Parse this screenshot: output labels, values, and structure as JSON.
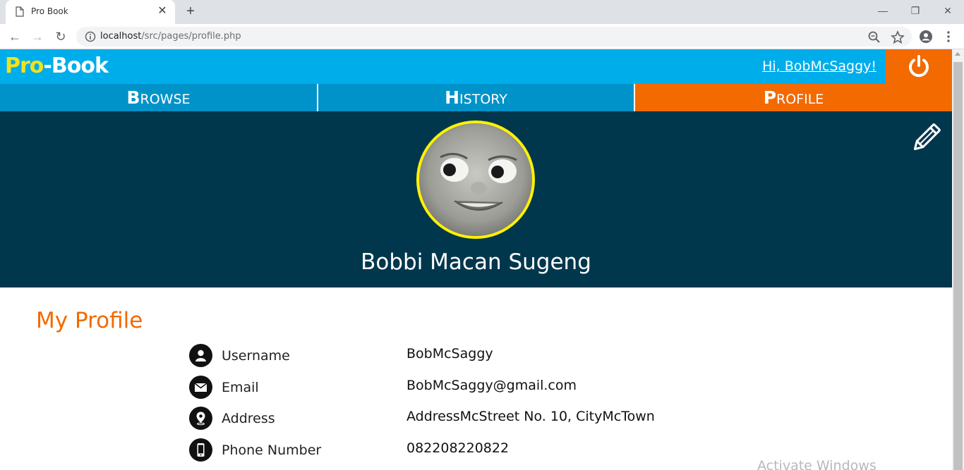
{
  "browser": {
    "tab_title": "Pro Book",
    "url_host": "localhost",
    "url_path": "/src/pages/profile.php"
  },
  "header": {
    "logo_pro": "Pro",
    "logo_book": "-Book",
    "greeting": "Hi, BobMcSaggy!"
  },
  "nav": {
    "browse": {
      "cap": "B",
      "rest": "ROWSE"
    },
    "history": {
      "cap": "H",
      "rest": "ISTORY"
    },
    "profile": {
      "cap": "P",
      "rest": "ROFILE"
    }
  },
  "profile": {
    "name": "Bobbi Macan Sugeng"
  },
  "section_title": "My Profile",
  "info": [
    {
      "label": "Username",
      "value": "BobMcSaggy",
      "icon": "user-icon"
    },
    {
      "label": "Email",
      "value": "BobMcSaggy@gmail.com",
      "icon": "envelope-icon"
    },
    {
      "label": "Address",
      "value": "AddressMcStreet No. 10, CityMcTown",
      "icon": "location-icon"
    },
    {
      "label": "Phone Number",
      "value": "082208220822",
      "icon": "phone-icon"
    }
  ],
  "watermark": "Activate Windows",
  "colors": {
    "header_blue": "#00adeb",
    "nav_blue": "#0093c9",
    "accent_orange": "#f26a00",
    "banner_navy": "#00374d",
    "logo_yellow": "#f2e21b",
    "avatar_border": "#fff200"
  }
}
